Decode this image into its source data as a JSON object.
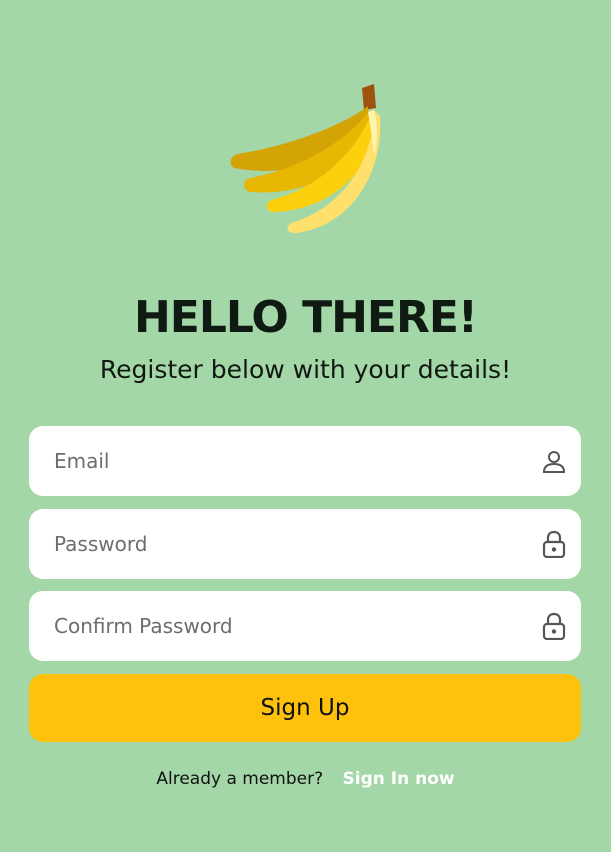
{
  "header": {
    "logo_icon": "banana-icon",
    "title": "HELLO THERE!",
    "subtitle": "Register below with your details!"
  },
  "form": {
    "email": {
      "placeholder": "Email",
      "value": "",
      "icon": "user-icon"
    },
    "password": {
      "placeholder": "Password",
      "value": "",
      "icon": "lock-icon"
    },
    "confirm_password": {
      "placeholder": "Confirm Password",
      "value": "",
      "icon": "lock-icon"
    },
    "submit_label": "Sign Up"
  },
  "footer": {
    "question": "Already a member?",
    "link_label": "Sign In now"
  },
  "colors": {
    "background": "#a4d7a7",
    "button": "#fec10c",
    "field": "#ffffff",
    "link": "#ffffff"
  }
}
